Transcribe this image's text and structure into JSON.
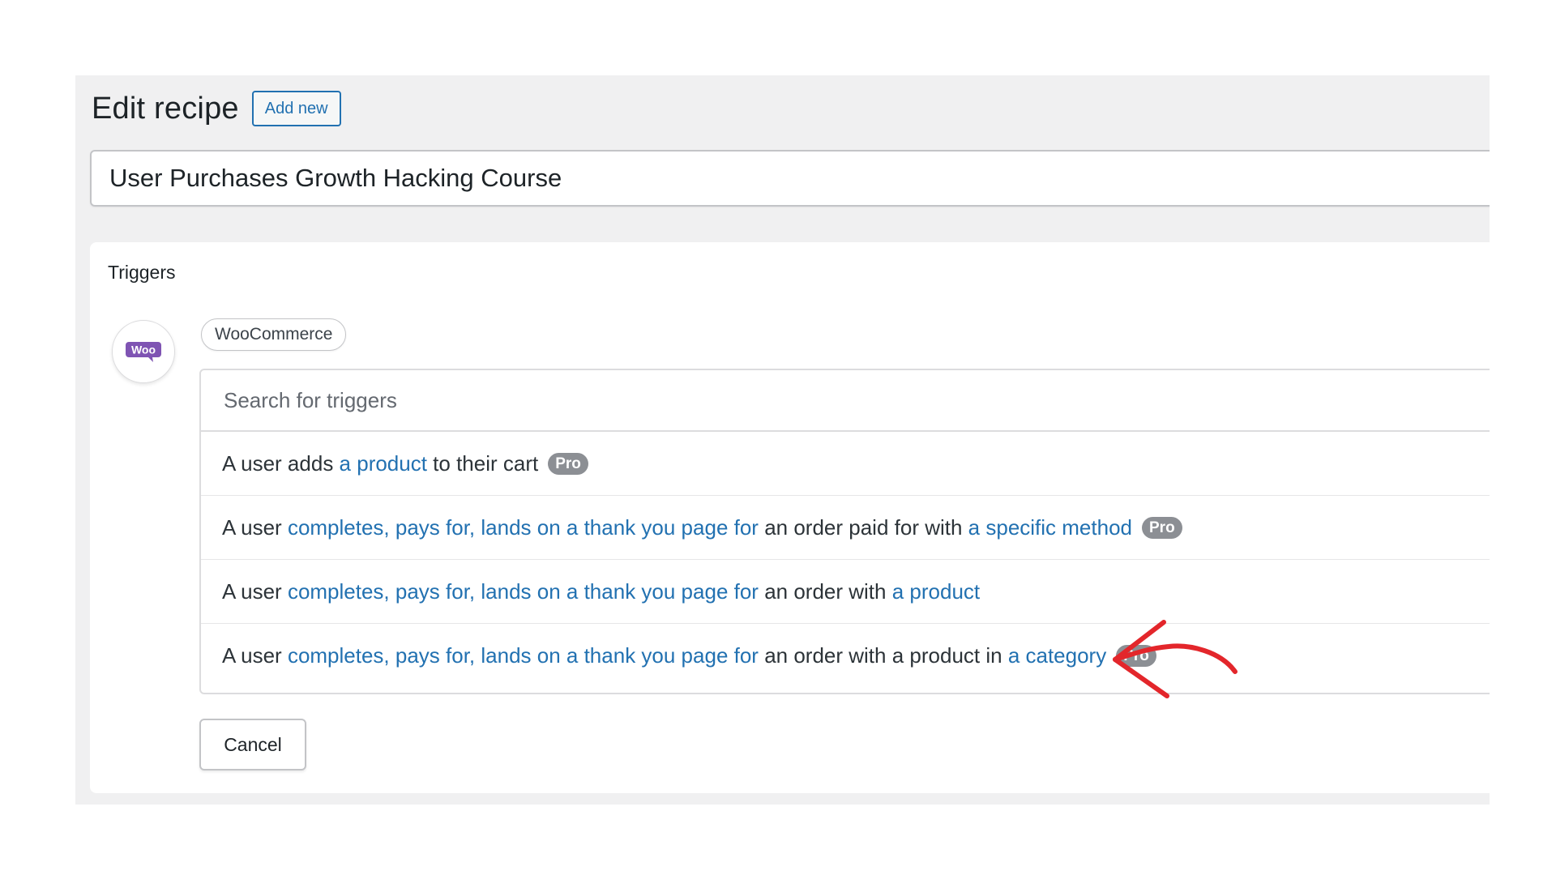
{
  "header": {
    "title": "Edit recipe",
    "add_new_label": "Add new"
  },
  "recipe": {
    "title_value": "User Purchases Growth Hacking Course"
  },
  "triggers": {
    "section_label": "Triggers",
    "integration_icon": "woo-logo-icon",
    "integration_icon_text": "Woo",
    "integration_name": "WooCommerce",
    "search_placeholder": "Search for triggers",
    "options": [
      {
        "segments": [
          {
            "text": "A user adds ",
            "token": false
          },
          {
            "text": "a product",
            "token": true
          },
          {
            "text": " to their cart",
            "token": false
          }
        ],
        "pro": true
      },
      {
        "segments": [
          {
            "text": "A user ",
            "token": false
          },
          {
            "text": "completes, pays for, lands on a thank you page for",
            "token": true
          },
          {
            "text": " an order paid for with ",
            "token": false
          },
          {
            "text": "a specific method",
            "token": true
          }
        ],
        "pro": true
      },
      {
        "segments": [
          {
            "text": "A user ",
            "token": false
          },
          {
            "text": "completes, pays for, lands on a thank you page for",
            "token": true
          },
          {
            "text": " an order with ",
            "token": false
          },
          {
            "text": "a product",
            "token": true
          }
        ],
        "pro": false
      },
      {
        "segments": [
          {
            "text": "A user ",
            "token": false
          },
          {
            "text": "completes, pays for, lands on a thank you page for",
            "token": true
          },
          {
            "text": " an order with a product in ",
            "token": false
          },
          {
            "text": "a category",
            "token": true
          }
        ],
        "pro": true
      }
    ],
    "pro_label": "Pro",
    "cancel_label": "Cancel"
  },
  "annotation": {
    "arrow_icon": "red-arrow-icon"
  },
  "colors": {
    "link": "#2271b1",
    "woo_purple": "#7f54b3",
    "pro_badge": "#8c8f94",
    "arrow": "#e3262b"
  }
}
